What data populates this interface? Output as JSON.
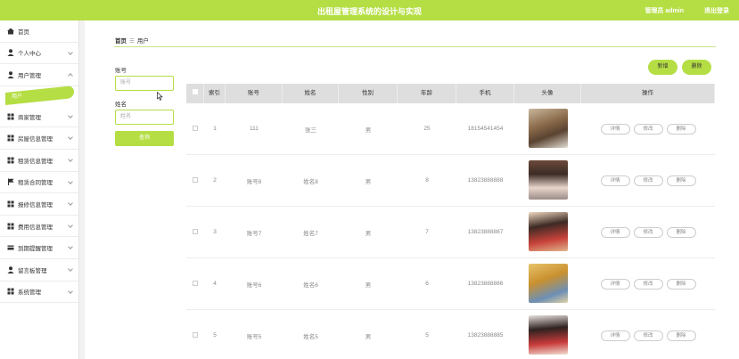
{
  "header": {
    "title": "出租屋管理系统的设计与实现",
    "user": "管理员 admin",
    "logout": "退出登录"
  },
  "sidebar": {
    "items": [
      {
        "label": "首页",
        "icon": "home-icon",
        "arrow": false
      },
      {
        "label": "个人中心",
        "icon": "person-icon",
        "arrow": true
      },
      {
        "label": "用户管理",
        "icon": "person-icon",
        "arrow": true
      },
      {
        "label": "商家管理",
        "icon": "grid-icon",
        "arrow": true
      },
      {
        "label": "房屋信息管理",
        "icon": "grid-icon",
        "arrow": true
      },
      {
        "label": "租赁信息管理",
        "icon": "grid-icon",
        "arrow": true
      },
      {
        "label": "租赁合同管理",
        "icon": "flag-icon",
        "arrow": true
      },
      {
        "label": "报修信息管理",
        "icon": "grid-icon",
        "arrow": true
      },
      {
        "label": "费用信息管理",
        "icon": "grid-icon",
        "arrow": true
      },
      {
        "label": "到期提醒管理",
        "icon": "card-icon",
        "arrow": true
      },
      {
        "label": "留言板管理",
        "icon": "person-icon",
        "arrow": true
      },
      {
        "label": "系统管理",
        "icon": "grid-icon",
        "arrow": true
      }
    ],
    "active_sub": "用户"
  },
  "breadcrumb": {
    "home": "首页",
    "current": "用户"
  },
  "search": {
    "account_label": "账号",
    "account_placeholder": "账号",
    "name_label": "姓名",
    "name_placeholder": "姓名",
    "button": "查询"
  },
  "actions": {
    "add": "新增",
    "delete": "删除"
  },
  "table": {
    "headers": [
      "",
      "索引",
      "账号",
      "姓名",
      "性别",
      "年龄",
      "手机",
      "头像",
      "操作"
    ],
    "rows": [
      {
        "index": "1",
        "account": "111",
        "name": "张三",
        "gender": "男",
        "age": "25",
        "phone": "18154541454"
      },
      {
        "index": "2",
        "account": "账号8",
        "name": "姓名8",
        "gender": "男",
        "age": "8",
        "phone": "13823888888"
      },
      {
        "index": "3",
        "account": "账号7",
        "name": "姓名7",
        "gender": "男",
        "age": "7",
        "phone": "13823888887"
      },
      {
        "index": "4",
        "account": "账号6",
        "name": "姓名6",
        "gender": "男",
        "age": "6",
        "phone": "13823888886"
      },
      {
        "index": "5",
        "account": "账号5",
        "name": "姓名5",
        "gender": "男",
        "age": "5",
        "phone": "13823888885"
      }
    ],
    "row_buttons": {
      "detail": "详情",
      "edit": "修改",
      "delete": "删除"
    }
  },
  "colors": {
    "accent": "#b5de44"
  }
}
